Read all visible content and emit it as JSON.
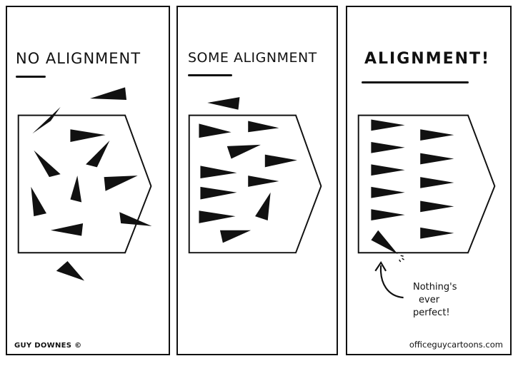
{
  "panels": [
    {
      "title": "NO ALIGNMENT"
    },
    {
      "title": "SOME ALIGNMENT"
    },
    {
      "title": "ALIGNMENT!"
    }
  ],
  "annotation": {
    "line1": "Nothing's",
    "line2": "ever",
    "line3": "perfect!"
  },
  "credit": "GUY DOWNES ©",
  "website": "officeguycartoons.com",
  "colors": {
    "ink": "#111111",
    "paper": "#ffffff"
  }
}
